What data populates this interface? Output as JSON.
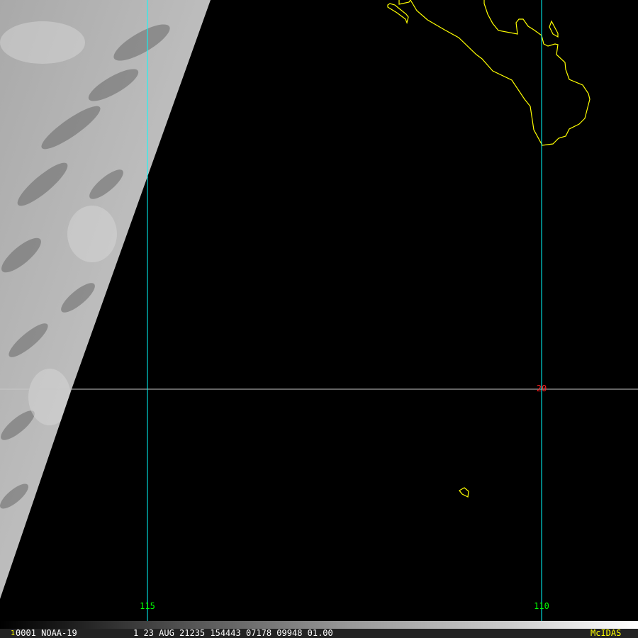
{
  "image": {
    "satellite": "NOAA-19",
    "coastline_color": "#ffff00",
    "longitude_line_color": "#00ffff",
    "latitude_line_color": "#c8c8c8"
  },
  "grid_labels": {
    "lon_115": "115",
    "lon_110": "110",
    "lat_20": "20"
  },
  "status_bar": {
    "frame_marker": "1",
    "info": "0001 NOAA-19",
    "details": "1 23 AUG 21235 154443 07178 09948 01.00",
    "brand": "McIDAS"
  }
}
